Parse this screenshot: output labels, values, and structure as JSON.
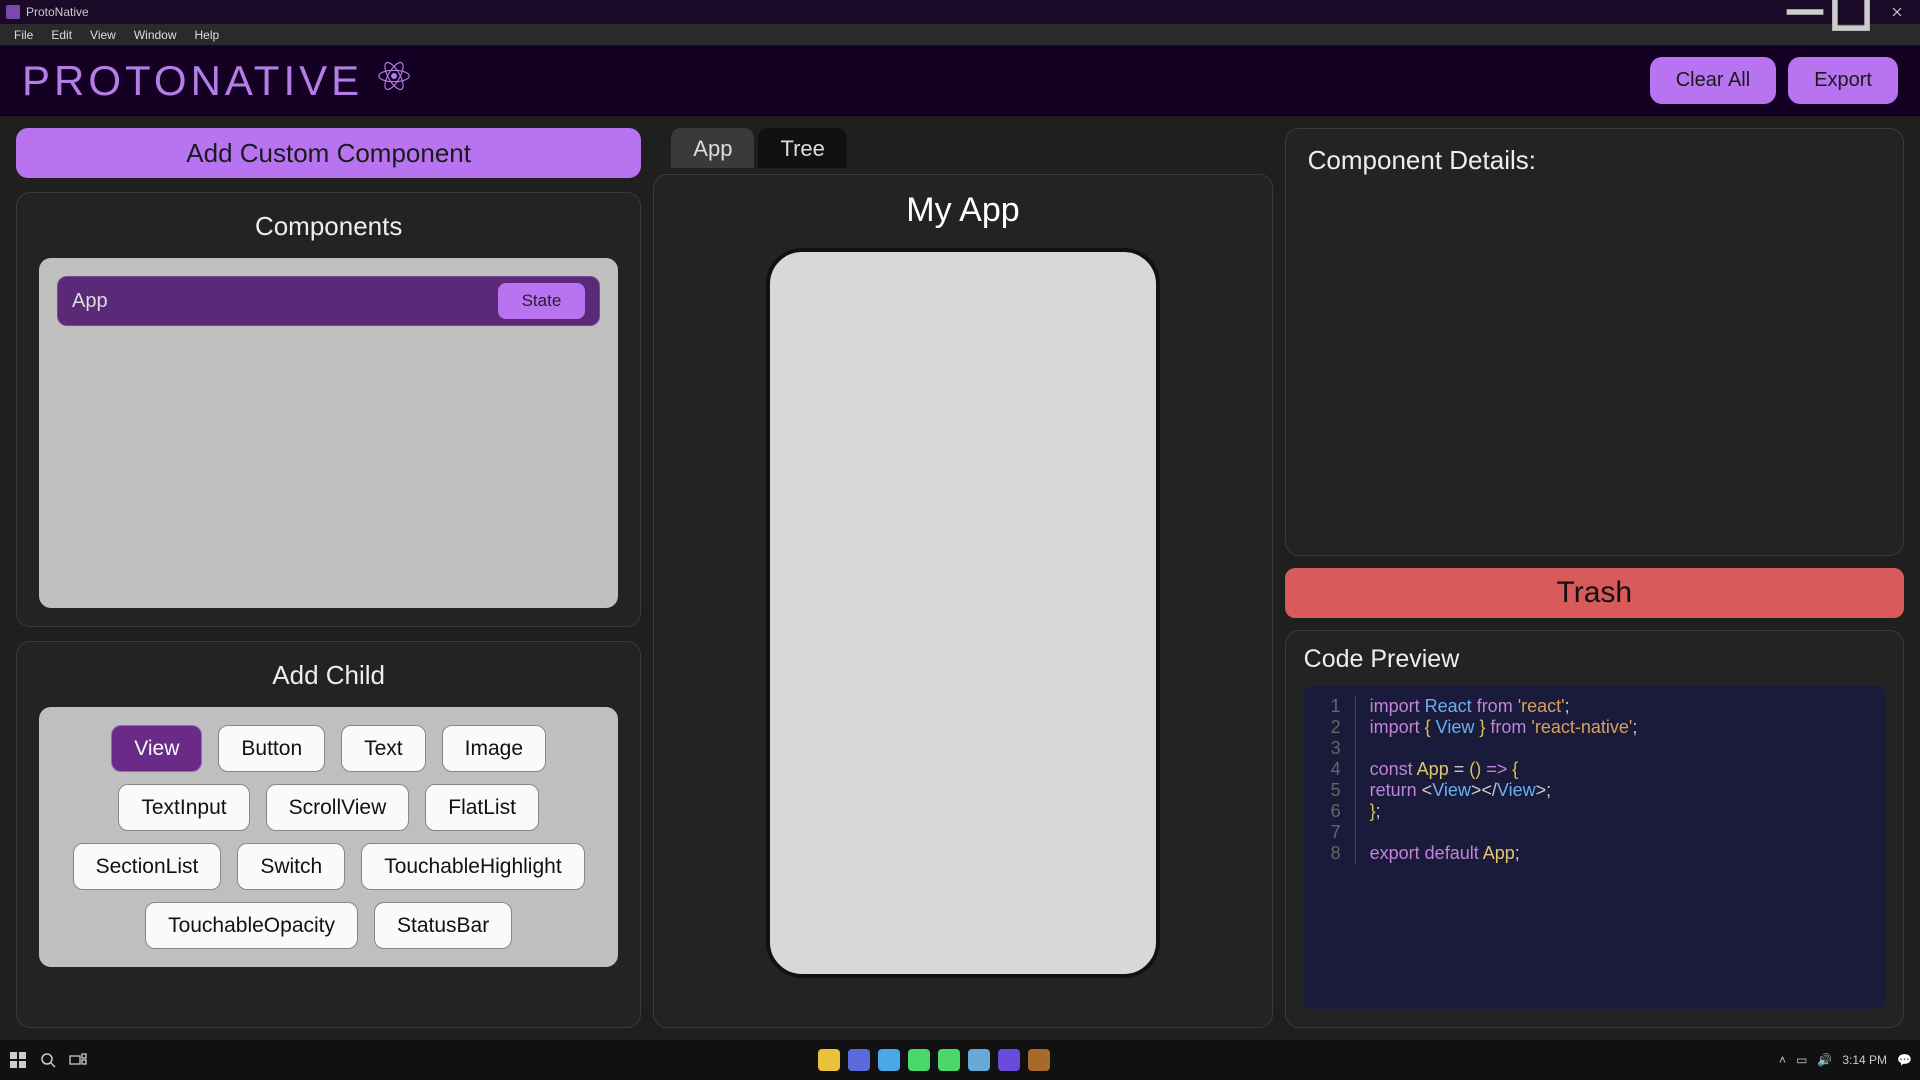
{
  "titlebar": {
    "title": "ProtoNative"
  },
  "menubar": [
    "File",
    "Edit",
    "View",
    "Window",
    "Help"
  ],
  "brand": {
    "name": "PROTONATIVE",
    "clear": "Clear All",
    "export": "Export"
  },
  "left": {
    "addCustom": "Add Custom Component",
    "componentsTitle": "Components",
    "componentItem": {
      "name": "App",
      "stateBtn": "State"
    },
    "addChildTitle": "Add Child",
    "chips": [
      "View",
      "Button",
      "Text",
      "Image",
      "TextInput",
      "ScrollView",
      "FlatList",
      "SectionList",
      "Switch",
      "TouchableHighlight",
      "TouchableOpacity",
      "StatusBar"
    ]
  },
  "mid": {
    "tabs": [
      "App",
      "Tree"
    ],
    "canvasTitle": "My App"
  },
  "right": {
    "detailsTitle": "Component Details:",
    "trash": "Trash",
    "codeTitle": "Code Preview",
    "code": [
      [
        [
          "kw",
          "import"
        ],
        [
          "",
          ""
        ],
        [
          "id",
          " React"
        ],
        [
          "",
          ""
        ],
        [
          "kw",
          " from"
        ],
        [
          "",
          ""
        ],
        [
          "str",
          " 'react'"
        ],
        [
          "punc",
          ";"
        ]
      ],
      [
        [
          "kw",
          "import"
        ],
        [
          "paren",
          " {"
        ],
        [
          "id",
          " View"
        ],
        [
          "paren",
          " }"
        ],
        [
          "kw",
          " from"
        ],
        [
          "str",
          " 'react-native'"
        ],
        [
          "punc",
          ";"
        ]
      ],
      [],
      [
        [
          "kw",
          "const"
        ],
        [
          "fn",
          " App"
        ],
        [
          "punc",
          " = "
        ],
        [
          "paren",
          "()"
        ],
        [
          "kw",
          " =>"
        ],
        [
          "paren",
          " {"
        ]
      ],
      [
        [
          "",
          "  "
        ],
        [
          "kw",
          "return"
        ],
        [
          "punc",
          " <"
        ],
        [
          "tag",
          "View"
        ],
        [
          "punc",
          "></"
        ],
        [
          "tag",
          "View"
        ],
        [
          "punc",
          ">;"
        ]
      ],
      [
        [
          "paren",
          "}"
        ],
        [
          "punc",
          ";"
        ]
      ],
      [],
      [
        [
          "kw",
          "export"
        ],
        [
          "kw",
          " default"
        ],
        [
          "fn",
          " App"
        ],
        [
          "punc",
          ";"
        ]
      ]
    ]
  },
  "taskbar": {
    "time": "3:14 PM",
    "apps": [
      "#e8c23a",
      "#5a6ad8",
      "#4aa8e8",
      "#4ad86a",
      "#4ad86a",
      "#68a8d8",
      "#6a4ad8",
      "#a86a2a"
    ]
  }
}
